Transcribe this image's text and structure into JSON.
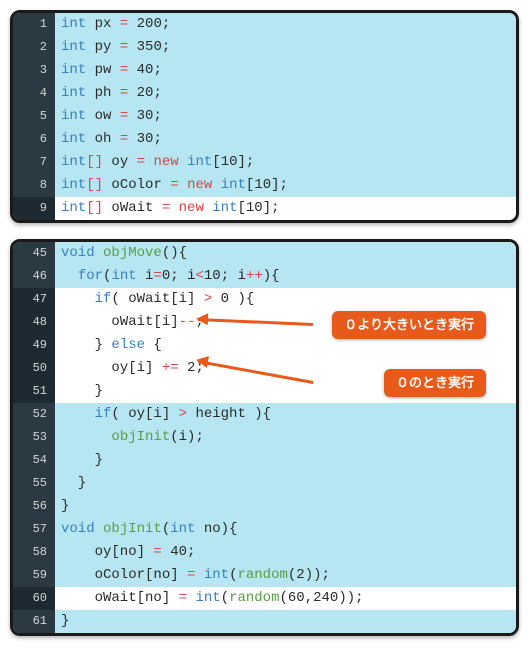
{
  "block1": {
    "lines": [
      {
        "n": "1",
        "hl": true,
        "tokens": [
          [
            "type",
            "int"
          ],
          [
            "",
            ""
          ],
          [
            "fn",
            " px "
          ],
          [
            "op",
            "="
          ],
          [
            "",
            " "
          ],
          [
            "num",
            "200"
          ],
          [
            "",
            ";"
          ]
        ]
      },
      {
        "n": "2",
        "hl": true,
        "tokens": [
          [
            "type",
            "int"
          ],
          [
            "fn",
            " py "
          ],
          [
            "op",
            "="
          ],
          [
            "",
            " "
          ],
          [
            "num",
            "350"
          ],
          [
            "",
            ";"
          ]
        ]
      },
      {
        "n": "3",
        "hl": true,
        "tokens": [
          [
            "type",
            "int"
          ],
          [
            "fn",
            " pw "
          ],
          [
            "op",
            "="
          ],
          [
            "",
            " "
          ],
          [
            "num",
            "40"
          ],
          [
            "",
            ";"
          ]
        ]
      },
      {
        "n": "4",
        "hl": true,
        "tokens": [
          [
            "type",
            "int"
          ],
          [
            "fn",
            " ph "
          ],
          [
            "op",
            "="
          ],
          [
            "",
            " "
          ],
          [
            "num",
            "20"
          ],
          [
            "",
            ";"
          ]
        ]
      },
      {
        "n": "5",
        "hl": true,
        "tokens": [
          [
            "type",
            "int"
          ],
          [
            "fn",
            " ow "
          ],
          [
            "op",
            "="
          ],
          [
            "",
            " "
          ],
          [
            "num",
            "30"
          ],
          [
            "",
            ";"
          ]
        ]
      },
      {
        "n": "6",
        "hl": true,
        "tokens": [
          [
            "type",
            "int"
          ],
          [
            "fn",
            " oh "
          ],
          [
            "op",
            "="
          ],
          [
            "",
            " "
          ],
          [
            "num",
            "30"
          ],
          [
            "",
            ";"
          ]
        ]
      },
      {
        "n": "7",
        "hl": true,
        "tokens": [
          [
            "type",
            "int"
          ],
          [
            "op",
            "[]"
          ],
          [
            "fn",
            " oy "
          ],
          [
            "op",
            "="
          ],
          [
            "",
            " "
          ],
          [
            "new",
            "new"
          ],
          [
            "",
            " "
          ],
          [
            "type",
            "int"
          ],
          [
            "",
            "["
          ],
          [
            "num",
            "10"
          ],
          [
            "",
            "];"
          ]
        ]
      },
      {
        "n": "8",
        "hl": true,
        "tokens": [
          [
            "type",
            "int"
          ],
          [
            "op",
            "[]"
          ],
          [
            "fn",
            " oColor "
          ],
          [
            "op",
            "="
          ],
          [
            "",
            " "
          ],
          [
            "new",
            "new"
          ],
          [
            "",
            " "
          ],
          [
            "type",
            "int"
          ],
          [
            "",
            "["
          ],
          [
            "num",
            "10"
          ],
          [
            "",
            "];"
          ]
        ]
      },
      {
        "n": "9",
        "hl": false,
        "tokens": [
          [
            "type",
            "int"
          ],
          [
            "op",
            "[]"
          ],
          [
            "fn",
            " oWait "
          ],
          [
            "op",
            "="
          ],
          [
            "",
            " "
          ],
          [
            "new",
            "new"
          ],
          [
            "",
            " "
          ],
          [
            "type",
            "int"
          ],
          [
            "",
            "["
          ],
          [
            "num",
            "10"
          ],
          [
            "",
            "];"
          ]
        ]
      }
    ]
  },
  "block2": {
    "lines": [
      {
        "n": "45",
        "hl": true,
        "tokens": [
          [
            "kw",
            "void"
          ],
          [
            "",
            " "
          ],
          [
            "call",
            "objMove"
          ],
          [
            "",
            "(){"
          ]
        ]
      },
      {
        "n": "46",
        "hl": true,
        "tokens": [
          [
            "",
            "  "
          ],
          [
            "kw",
            "for"
          ],
          [
            "",
            "("
          ],
          [
            "type",
            "int"
          ],
          [
            "",
            " i"
          ],
          [
            "op",
            "="
          ],
          [
            "num",
            "0"
          ],
          [
            "",
            "; i"
          ],
          [
            "op",
            "<"
          ],
          [
            "num",
            "10"
          ],
          [
            "",
            "; i"
          ],
          [
            "op",
            "++"
          ],
          [
            "",
            "){"
          ]
        ]
      },
      {
        "n": "47",
        "hl": false,
        "tokens": [
          [
            "",
            "    "
          ],
          [
            "kw",
            "if"
          ],
          [
            "",
            "( oWait[i] "
          ],
          [
            "op",
            ">"
          ],
          [
            "",
            " "
          ],
          [
            "num",
            "0"
          ],
          [
            "",
            " ){"
          ]
        ]
      },
      {
        "n": "48",
        "hl": false,
        "tokens": [
          [
            "",
            "      oWait[i]"
          ],
          [
            "op",
            "--"
          ],
          [
            "",
            ";"
          ]
        ]
      },
      {
        "n": "49",
        "hl": false,
        "tokens": [
          [
            "",
            "    } "
          ],
          [
            "kw",
            "else"
          ],
          [
            "",
            " {"
          ]
        ]
      },
      {
        "n": "50",
        "hl": false,
        "tokens": [
          [
            "",
            "      oy[i] "
          ],
          [
            "op",
            "+="
          ],
          [
            "",
            " "
          ],
          [
            "num",
            "2"
          ],
          [
            "",
            ";"
          ]
        ]
      },
      {
        "n": "51",
        "hl": false,
        "tokens": [
          [
            "",
            "    }"
          ]
        ]
      },
      {
        "n": "52",
        "hl": true,
        "tokens": [
          [
            "",
            "    "
          ],
          [
            "kw",
            "if"
          ],
          [
            "",
            "( oy[i] "
          ],
          [
            "op",
            ">"
          ],
          [
            "",
            " height ){"
          ]
        ]
      },
      {
        "n": "53",
        "hl": true,
        "tokens": [
          [
            "",
            "      "
          ],
          [
            "call",
            "objInit"
          ],
          [
            "",
            "(i);"
          ]
        ]
      },
      {
        "n": "54",
        "hl": true,
        "tokens": [
          [
            "",
            "    }"
          ]
        ]
      },
      {
        "n": "55",
        "hl": true,
        "tokens": [
          [
            "",
            "  }"
          ]
        ]
      },
      {
        "n": "56",
        "hl": true,
        "tokens": [
          [
            "",
            "}"
          ]
        ]
      },
      {
        "n": "57",
        "hl": true,
        "tokens": [
          [
            "kw",
            "void"
          ],
          [
            "",
            " "
          ],
          [
            "call",
            "objInit"
          ],
          [
            "",
            "("
          ],
          [
            "type",
            "int"
          ],
          [
            "",
            " no){"
          ]
        ]
      },
      {
        "n": "58",
        "hl": true,
        "tokens": [
          [
            "",
            "    oy[no] "
          ],
          [
            "op",
            "="
          ],
          [
            "",
            " "
          ],
          [
            "num",
            "40"
          ],
          [
            "",
            ";"
          ]
        ]
      },
      {
        "n": "59",
        "hl": true,
        "tokens": [
          [
            "",
            "    oColor[no] "
          ],
          [
            "op",
            "="
          ],
          [
            "",
            " "
          ],
          [
            "type",
            "int"
          ],
          [
            "",
            "("
          ],
          [
            "call",
            "random"
          ],
          [
            "",
            "("
          ],
          [
            "num",
            "2"
          ],
          [
            "",
            "));"
          ]
        ]
      },
      {
        "n": "60",
        "hl": false,
        "tokens": [
          [
            "",
            "    oWait[no] "
          ],
          [
            "op",
            "="
          ],
          [
            "",
            " "
          ],
          [
            "type",
            "int"
          ],
          [
            "",
            "("
          ],
          [
            "call",
            "random"
          ],
          [
            "",
            "("
          ],
          [
            "num",
            "60"
          ],
          [
            "",
            ","
          ],
          [
            "num",
            "240"
          ],
          [
            "",
            "));"
          ]
        ]
      },
      {
        "n": "61",
        "hl": true,
        "tokens": [
          [
            "",
            "}"
          ]
        ]
      }
    ]
  },
  "callouts": [
    {
      "text": "０より大きいとき実行",
      "targetLine": "48"
    },
    {
      "text": "０のとき実行",
      "targetLine": "50"
    }
  ]
}
